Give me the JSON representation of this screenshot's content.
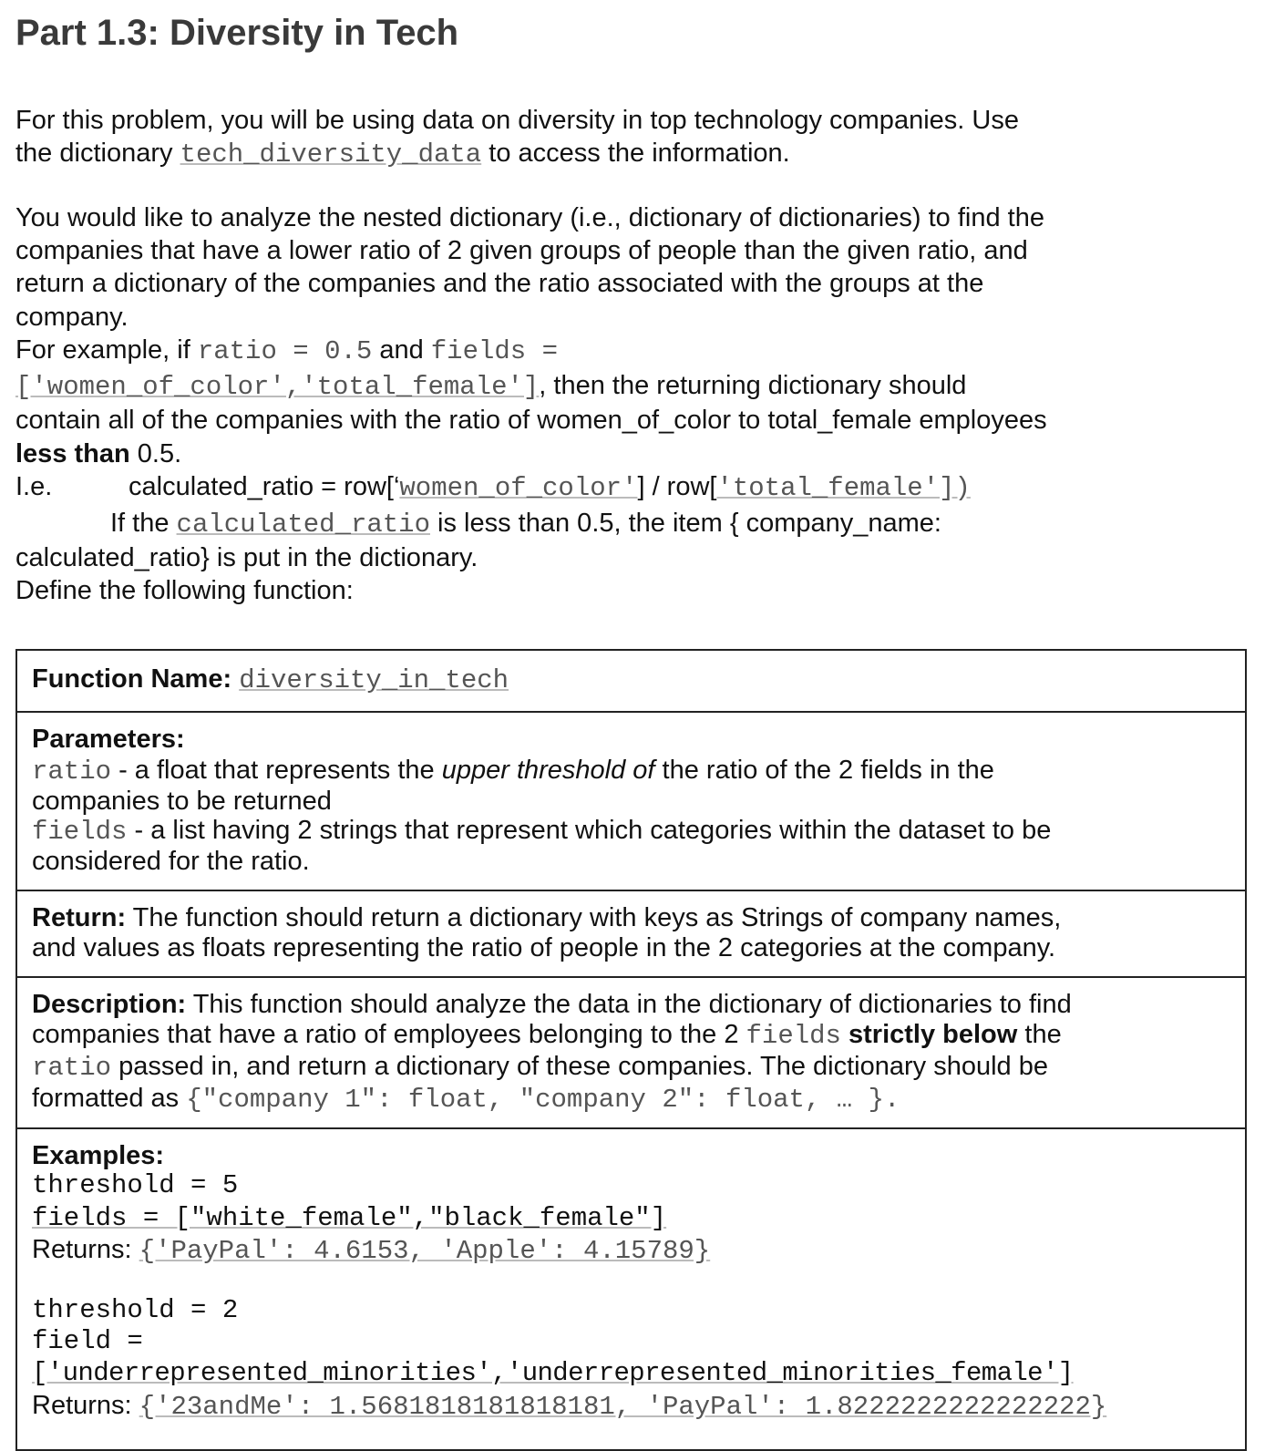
{
  "title": "Part 1.3: Diversity in Tech",
  "intro": {
    "l1": "For this problem, you will be using data on diversity in top technology companies. Use",
    "l2a": "the dictionary ",
    "l2code": "tech_diversity_data",
    "l2b": " to access the information."
  },
  "para": {
    "l1": "You would like to analyze the nested dictionary (i.e., dictionary of dictionaries) to find the",
    "l2": "companies that have a lower ratio of 2 given groups of people than the given ratio, and",
    "l3": "return a dictionary of the companies and the ratio associated with the groups at the",
    "l4": "company.",
    "ex_a": "For example, if ",
    "ex_code1": "ratio = 0.5",
    "ex_b": " and ",
    "ex_code2": "fields =",
    "ex_code3": "['women_of_color','total_female']",
    "ex_c": ", then the returning dictionary should",
    "l7": "contain all of the companies with the ratio of women_of_color to total_female employees",
    "l8b": "less than",
    "l8": " 0.5.",
    "ie": "I.e.",
    "calc_a": "calculated_ratio = row[‘",
    "calc_code1": "women_of_color'",
    "calc_b": "] / row[",
    "calc_code2": "'total_female'])",
    "if_a": "If the ",
    "if_code": "calculated_ratio",
    "if_b": " is less than 0.5, the item { company_name:",
    "l11": "calculated_ratio} is put in the dictionary.",
    "l12": "Define the following function:"
  },
  "box": {
    "fname_label": "Function Name:",
    "fname": "diversity_in_tech",
    "params_label": "Parameters:",
    "p1_code": "ratio",
    "p1_a": " - a float that represents the ",
    "p1_i": "upper threshold of",
    "p1_b": " the ratio of the 2 fields in the",
    "p1_l2": "companies to be returned",
    "p2_code": "fields",
    "p2_a": " - a list having 2 strings that represent which categories within the dataset to be",
    "p2_l2": "considered for the ratio.",
    "return_label": "Return:",
    "return_l1": " The function should return a dictionary with keys as Strings of company names,",
    "return_l2": "and values as floats representing the ratio of people in the 2 categories at the company.",
    "desc_label": "Description:",
    "desc_l1": " This function should analyze the data in the dictionary of dictionaries to find",
    "desc_l2a": "companies that have a ratio of employees belonging to the 2 ",
    "desc_l2code": "fields",
    "desc_l2b": "strictly below",
    "desc_l2c": " the",
    "desc_l3code": "ratio",
    "desc_l3a": " passed in, and return a dictionary of these companies. The dictionary should be",
    "desc_l4a": "formatted as ",
    "desc_l4code": "{\"company 1\": float, \"company 2\": float, … }.",
    "examples_label": "Examples:",
    "ex1_threshold": "threshold = 5",
    "ex1_fields": "fields = [\"white_female\",\"black_female\"]",
    "returns_label": "Returns:",
    "ex1_returns": "{'PayPal': 4.6153, 'Apple': 4.15789}",
    "ex2_threshold": "threshold = 2",
    "ex2_field": "field =",
    "ex2_list": "['underrepresented_minorities','underrepresented_minorities_female']",
    "ex2_returns": "{'23andMe': 1.5681818181818181, 'PayPal': 1.8222222222222222}"
  }
}
